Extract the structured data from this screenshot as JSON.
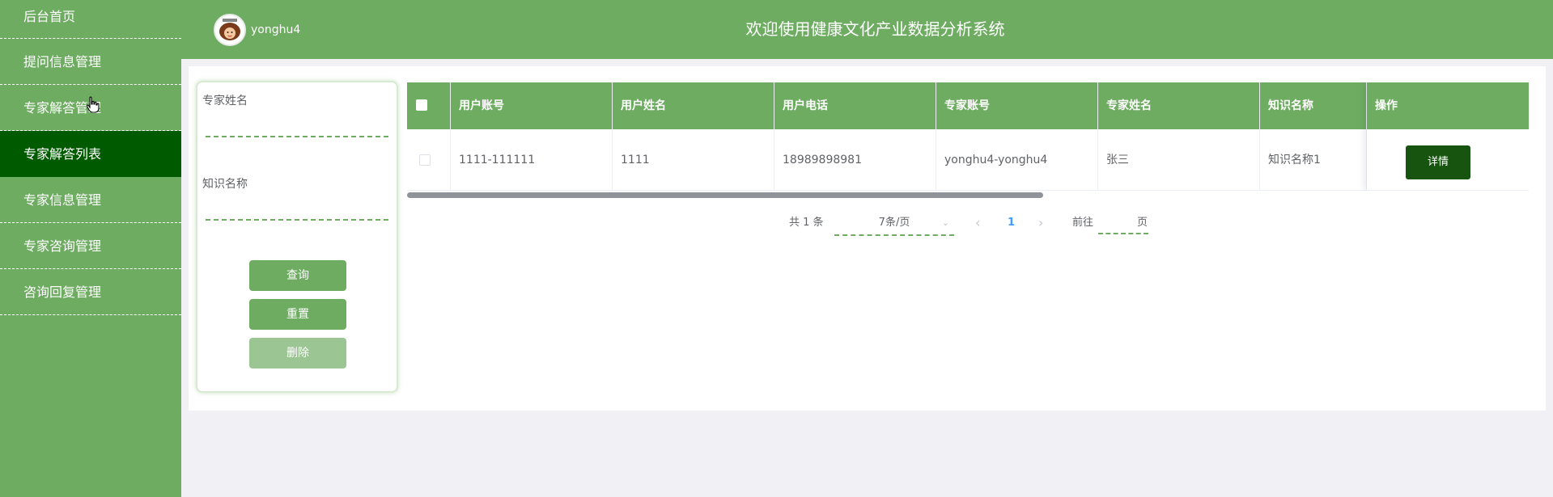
{
  "sidebar": {
    "items": [
      {
        "label": "后台首页"
      },
      {
        "label": "提问信息管理"
      },
      {
        "label": "专家解答管理"
      },
      {
        "label": "专家解答列表"
      },
      {
        "label": "专家信息管理"
      },
      {
        "label": "专家咨询管理"
      },
      {
        "label": "咨询回复管理"
      }
    ],
    "active_index": 3
  },
  "header": {
    "username": "yonghu4",
    "title": "欢迎使用健康文化产业数据分析系统"
  },
  "search": {
    "expert_name_label": "专家姓名",
    "expert_name_value": "",
    "knowledge_name_label": "知识名称",
    "knowledge_name_value": "",
    "query_button": "查询",
    "reset_button": "重置",
    "delete_button": "删除"
  },
  "table": {
    "columns": [
      "用户账号",
      "用户姓名",
      "用户电话",
      "专家账号",
      "专家姓名",
      "知识名称",
      "操作"
    ],
    "rows": [
      {
        "user_account": "1111-111111",
        "user_name": "1111",
        "user_phone": "18989898981",
        "expert_account": "yonghu4-yonghu4",
        "expert_name": "张三",
        "knowledge_name": "知识名称1",
        "action": "详情"
      }
    ]
  },
  "pagination": {
    "total": "共 1 条",
    "page_size": "7条/页",
    "current_page": "1",
    "goto_label": "前往",
    "goto_value": "",
    "page_suffix": "页"
  },
  "colors": {
    "primary": "#6eac62",
    "active_menu": "#005b00",
    "detail_button": "#16540f"
  }
}
